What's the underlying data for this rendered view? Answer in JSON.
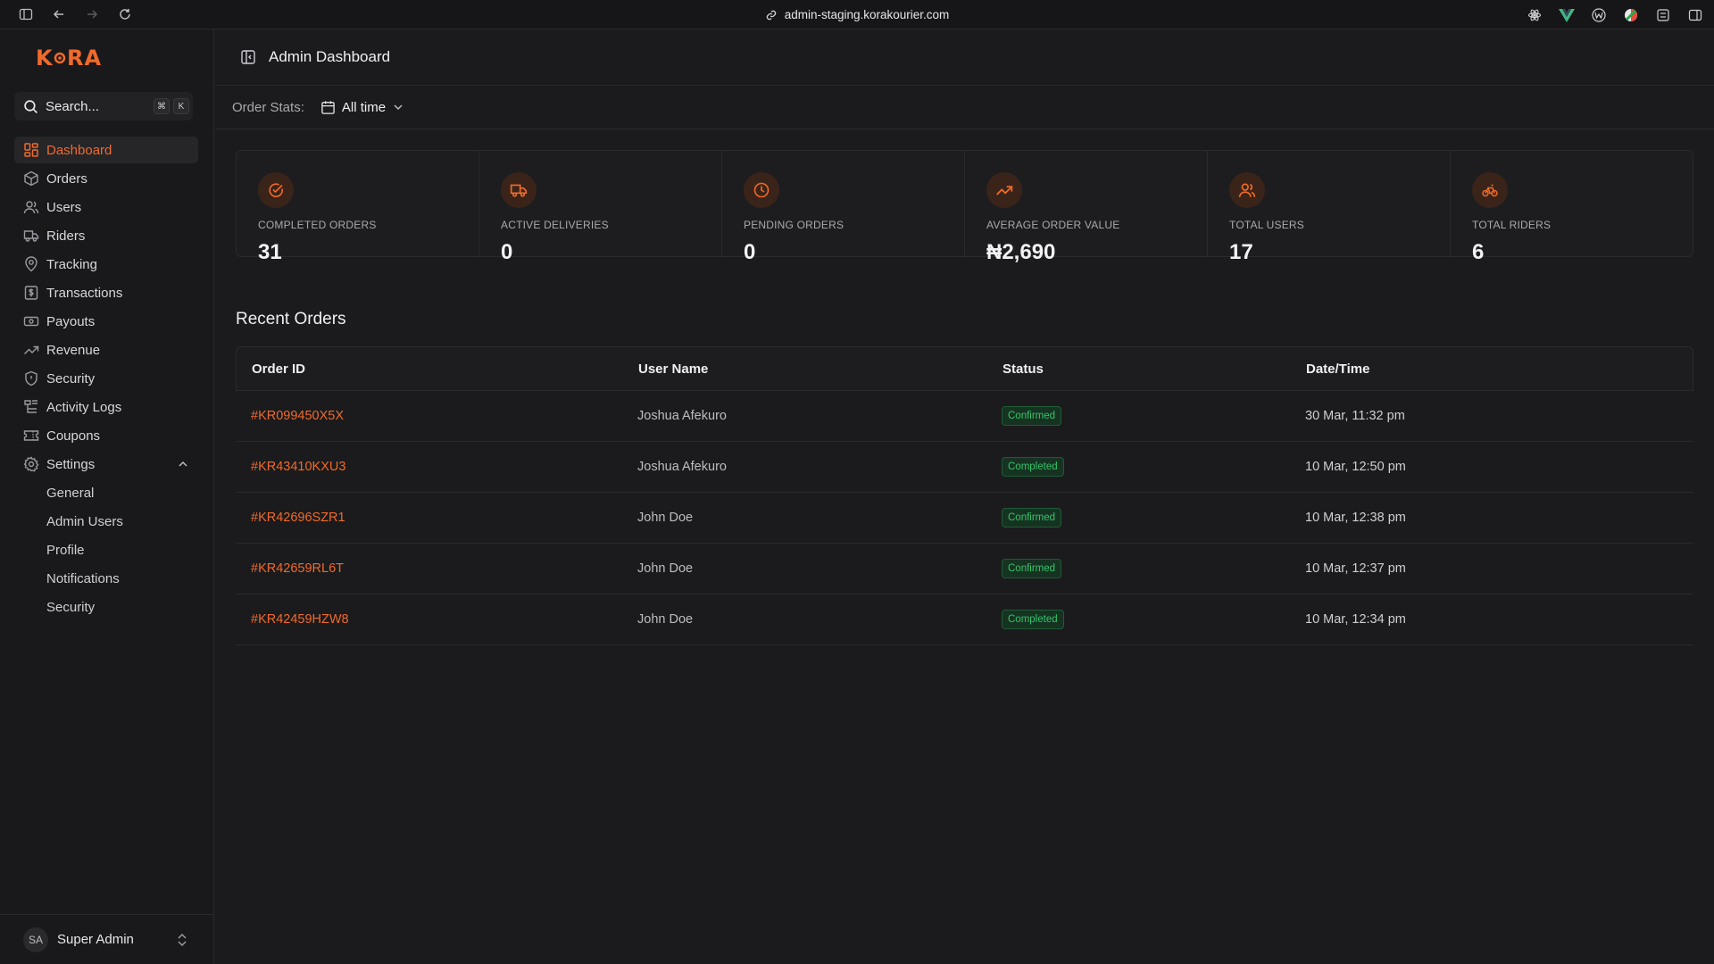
{
  "browser": {
    "url": "admin-staging.korakourier.com",
    "extensions": [
      "atom-extension-icon",
      "vue-devtools-icon",
      "extension-w-icon",
      "colorful-extension-icon",
      "tab-manager-icon",
      "split-view-icon"
    ]
  },
  "sidebar": {
    "logo": "K•RA",
    "search": {
      "placeholder": "Search...",
      "shortcut_mod": "⌘",
      "shortcut_key": "K"
    },
    "items": [
      {
        "label": "Dashboard",
        "icon": "dashboard-icon",
        "active": true
      },
      {
        "label": "Orders",
        "icon": "package-icon"
      },
      {
        "label": "Users",
        "icon": "users-icon"
      },
      {
        "label": "Riders",
        "icon": "truck-icon"
      },
      {
        "label": "Tracking",
        "icon": "map-pin-icon"
      },
      {
        "label": "Transactions",
        "icon": "receipt-icon"
      },
      {
        "label": "Payouts",
        "icon": "banknote-icon"
      },
      {
        "label": "Revenue",
        "icon": "trending-up-icon"
      },
      {
        "label": "Security",
        "icon": "shield-icon"
      },
      {
        "label": "Activity Logs",
        "icon": "logs-icon"
      },
      {
        "label": "Coupons",
        "icon": "ticket-icon"
      },
      {
        "label": "Settings",
        "icon": "gear-icon",
        "expanded": true
      }
    ],
    "settings_sub": [
      "General",
      "Admin Users",
      "Profile",
      "Notifications",
      "Security"
    ],
    "user": {
      "initials": "SA",
      "name": "Super Admin"
    }
  },
  "header": {
    "title": "Admin Dashboard"
  },
  "stats_bar": {
    "label": "Order Stats:",
    "range": "All time"
  },
  "stats": [
    {
      "label": "COMPLETED ORDERS",
      "value": "31",
      "icon": "check-circle-icon"
    },
    {
      "label": "ACTIVE DELIVERIES",
      "value": "0",
      "icon": "truck-icon"
    },
    {
      "label": "PENDING ORDERS",
      "value": "0",
      "icon": "clock-icon"
    },
    {
      "label": "AVERAGE ORDER VALUE",
      "value": "₦2,690",
      "icon": "trending-up-icon"
    },
    {
      "label": "TOTAL USERS",
      "value": "17",
      "icon": "users-icon"
    },
    {
      "label": "TOTAL RIDERS",
      "value": "6",
      "icon": "bike-icon"
    }
  ],
  "recent_orders": {
    "title": "Recent Orders",
    "columns": [
      "Order ID",
      "User Name",
      "Status",
      "Date/Time"
    ],
    "rows": [
      {
        "id": "#KR099450X5X",
        "user": "Joshua Afekuro",
        "status": "Confirmed",
        "date": "30 Mar, 11:32 pm"
      },
      {
        "id": "#KR43410KXU3",
        "user": "Joshua Afekuro",
        "status": "Completed",
        "date": "10 Mar, 12:50 pm"
      },
      {
        "id": "#KR42696SZR1",
        "user": "John Doe",
        "status": "Confirmed",
        "date": "10 Mar, 12:38 pm"
      },
      {
        "id": "#KR42659RL6T",
        "user": "John Doe",
        "status": "Confirmed",
        "date": "10 Mar, 12:37 pm"
      },
      {
        "id": "#KR42459HZW8",
        "user": "John Doe",
        "status": "Completed",
        "date": "10 Mar, 12:34 pm"
      }
    ]
  },
  "colors": {
    "accent": "#f06a2a",
    "success": "#35c46a",
    "background": "#1b1b1d"
  }
}
